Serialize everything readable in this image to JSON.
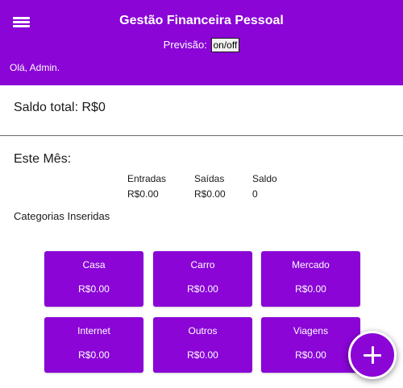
{
  "header": {
    "title": "Gestão Financeira Pessoal",
    "forecast_label": "Previsão:",
    "forecast_toggle": "on/off",
    "greeting": "Olá, Admin.",
    "menu_icon": "hamburger-menu-icon"
  },
  "balance": {
    "total_text": "Saldo total: R$0"
  },
  "month": {
    "title": "Este Mês:",
    "columns": [
      {
        "label": "Entradas",
        "value": "R$0.00"
      },
      {
        "label": "Saídas",
        "value": "R$0.00"
      },
      {
        "label": "Saldo",
        "value": "0"
      }
    ]
  },
  "categories": {
    "title": "Categorias Inseridas",
    "items": [
      {
        "name": "Casa",
        "amount": "R$0.00"
      },
      {
        "name": "Carro",
        "amount": "R$0.00"
      },
      {
        "name": "Mercado",
        "amount": "R$0.00"
      },
      {
        "name": "Internet",
        "amount": "R$0.00"
      },
      {
        "name": "Outros",
        "amount": "R$0.00"
      },
      {
        "name": "Viagens",
        "amount": "R$0.00"
      }
    ]
  },
  "fab": {
    "icon": "plus-icon"
  },
  "colors": {
    "primary": "#8a05d6",
    "header_text": "#ffffff",
    "divider": "#6b6b6b"
  }
}
